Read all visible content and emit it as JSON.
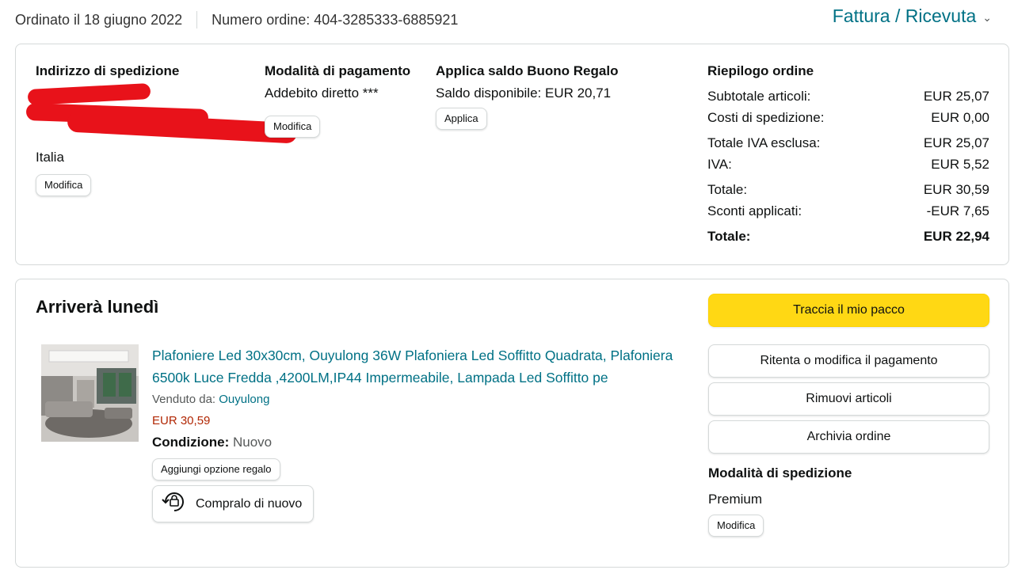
{
  "header": {
    "order_date": "Ordinato il 18 giugno 2022",
    "order_number": "Numero ordine: 404-3285333-6885921",
    "invoice_link": "Fattura / Ricevuta"
  },
  "shipping_address": {
    "title": "Indirizzo di spedizione",
    "country": "Italia",
    "edit": "Modifica"
  },
  "payment": {
    "title": "Modalità di pagamento",
    "method": "Addebito diretto ***",
    "edit": "Modifica"
  },
  "gift_card": {
    "title": "Applica saldo Buono Regalo",
    "balance": "Saldo disponibile: EUR 20,71",
    "apply": "Applica"
  },
  "summary": {
    "title": "Riepilogo ordine",
    "rows": [
      {
        "label": "Subtotale articoli:",
        "value": "EUR 25,07"
      },
      {
        "label": "Costi di spedizione:",
        "value": "EUR 0,00"
      },
      {
        "label": "Totale IVA esclusa:",
        "value": "EUR 25,07"
      },
      {
        "label": "IVA:",
        "value": "EUR 5,52"
      },
      {
        "label": "Totale:",
        "value": "EUR 30,59"
      },
      {
        "label": "Sconti applicati:",
        "value": "-EUR 7,65"
      }
    ],
    "grand_total_label": "Totale:",
    "grand_total_value": "EUR 22,94"
  },
  "shipment": {
    "title": "Arriverà lunedì",
    "product_title": "Plafoniere Led 30x30cm, Ouyulong 36W Plafoniera Led Soffitto Quadrata, Plafoniera 6500k Luce Fredda ,4200LM,IP44 Impermeabile, Lampada Led Soffitto pe",
    "sold_by_label": "Venduto da:",
    "seller": "Ouyulong",
    "price": "EUR 30,59",
    "condition_label": "Condizione:",
    "condition_value": "Nuovo",
    "gift_option": "Aggiungi opzione regalo",
    "buy_again": "Compralo di nuovo"
  },
  "actions": {
    "track": "Traccia il mio pacco",
    "retry_payment": "Ritenta o modifica il pagamento",
    "remove_items": "Rimuovi articoli",
    "archive": "Archivia ordine"
  },
  "shipping_method": {
    "title": "Modalità di spedizione",
    "value": "Premium",
    "edit": "Modifica"
  },
  "colors": {
    "link": "#007185",
    "price": "#b12704",
    "primary_button": "#ffd814",
    "redaction": "#e8121a"
  }
}
